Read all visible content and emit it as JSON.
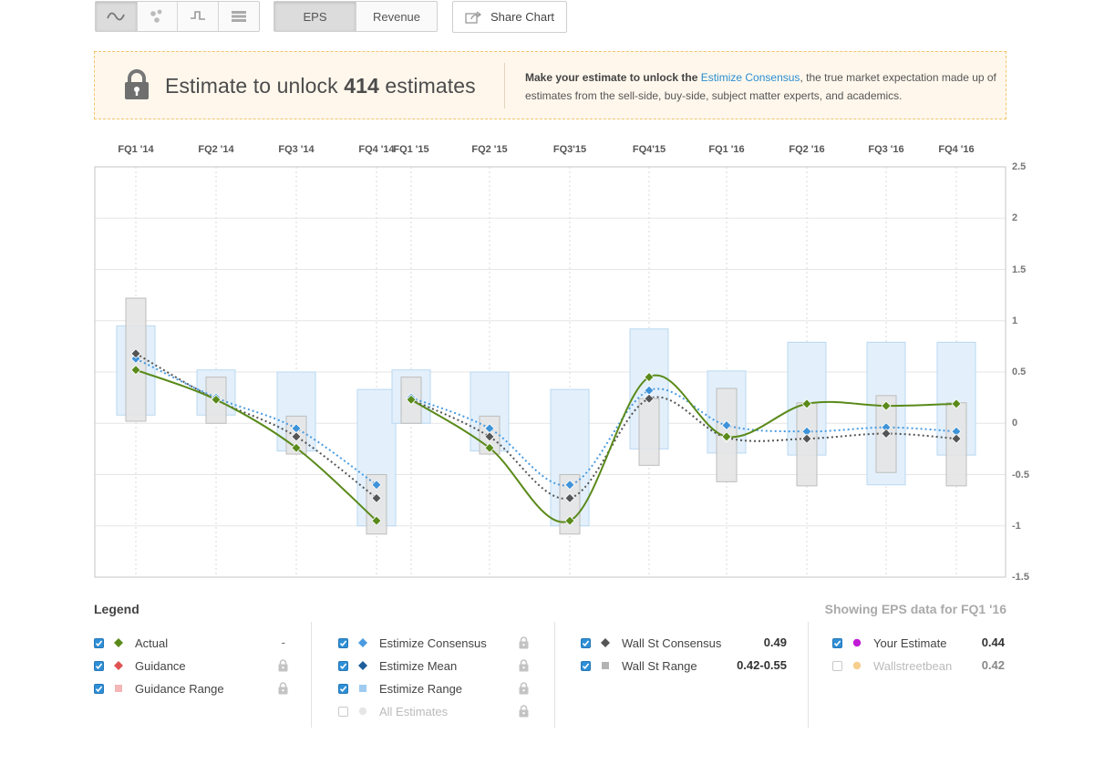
{
  "toolbar": {
    "view_icons": [
      "line-chart-icon",
      "scatter-icon",
      "step-chart-icon",
      "table-icon"
    ],
    "metric_tabs": [
      "EPS",
      "Revenue"
    ],
    "share_label": "Share Chart"
  },
  "banner": {
    "headline_prefix": "Estimate to unlock ",
    "headline_count": "414",
    "headline_suffix": " estimates",
    "text_lead": "Make your estimate to unlock the ",
    "text_link": "Estimize Consensus",
    "text_rest": ", the true market expectation made up of estimates from the sell-side, buy-side, subject matter experts, and academics."
  },
  "chart_data": {
    "type": "line",
    "categories": [
      "FQ1 '14",
      "FQ2 '14",
      "FQ3 '14",
      "FQ4 '14",
      "FQ1 '15",
      "FQ2 '15",
      "FQ3'15",
      "FQ4'15",
      "FQ1 '16",
      "FQ2 '16",
      "FQ3 '16",
      "FQ4 '16"
    ],
    "y_ticks": [
      "2.5",
      "2",
      "1.5",
      "1",
      "0.5",
      "0",
      "-0.5",
      "-1",
      "-1.5"
    ],
    "ylim": [
      -1.5,
      2.5
    ],
    "grid": true,
    "series": [
      {
        "name": "Actual",
        "color": "#5a8a1a",
        "values": [
          0.52,
          0.23,
          -0.24,
          -0.95,
          0.23,
          -0.24,
          -0.95,
          0.45,
          -0.13,
          0.19,
          0.17,
          0.19
        ]
      },
      {
        "name": "Estimize Consensus",
        "color": "#3f93d8",
        "values": [
          0.63,
          0.25,
          -0.05,
          -0.6,
          0.25,
          -0.05,
          -0.6,
          0.32,
          -0.02,
          -0.08,
          -0.04,
          -0.08
        ]
      },
      {
        "name": "Wall St Consensus",
        "color": "#555555",
        "values": [
          0.68,
          0.23,
          -0.13,
          -0.73,
          0.23,
          -0.13,
          -0.73,
          0.24,
          -0.14,
          -0.15,
          -0.1,
          -0.15
        ]
      }
    ],
    "estimize_range": [
      [
        0.08,
        0.95
      ],
      [
        0.08,
        0.52
      ],
      [
        -0.27,
        0.5
      ],
      [
        -1.0,
        0.33
      ],
      [
        0.0,
        0.52
      ],
      [
        -0.27,
        0.5
      ],
      [
        -1.0,
        0.33
      ],
      [
        -0.25,
        0.92
      ],
      [
        -0.29,
        0.51
      ],
      [
        -0.31,
        0.79
      ],
      [
        -0.6,
        0.79
      ],
      [
        -0.31,
        0.79
      ]
    ],
    "wallst_range": [
      [
        0.02,
        1.22
      ],
      [
        0.0,
        0.45
      ],
      [
        -0.3,
        0.07
      ],
      [
        -1.08,
        -0.5
      ],
      [
        0.0,
        0.45
      ],
      [
        -0.3,
        0.07
      ],
      [
        -1.08,
        -0.5
      ],
      [
        -0.41,
        0.24
      ],
      [
        -0.57,
        0.34
      ],
      [
        -0.61,
        0.2
      ],
      [
        -0.48,
        0.27
      ],
      [
        -0.61,
        0.2
      ]
    ]
  },
  "legend": {
    "title": "Legend",
    "showing": "Showing EPS data for FQ1 '16",
    "col1": [
      {
        "label": "Actual",
        "value": "-",
        "marker": "diamond",
        "color": "#5a8a1a",
        "checked": true
      },
      {
        "label": "Guidance",
        "marker": "diamond",
        "color": "#e05252",
        "checked": true,
        "locked": true
      },
      {
        "label": "Guidance Range",
        "marker": "square",
        "color": "#f4b6b6",
        "checked": true,
        "locked": true
      }
    ],
    "col2": [
      {
        "label": "Estimize Consensus",
        "marker": "diamond",
        "color": "#4a9be0",
        "checked": true,
        "locked": true
      },
      {
        "label": "Estimize Mean",
        "marker": "diamond",
        "color": "#1d5e9c",
        "checked": true,
        "locked": true
      },
      {
        "label": "Estimize Range",
        "marker": "square",
        "color": "#9fcbf0",
        "checked": true,
        "locked": true
      },
      {
        "label": "All Estimates",
        "marker": "circle",
        "color": "#e6e6e6",
        "checked": false,
        "locked": true
      }
    ],
    "col3": [
      {
        "label": "Wall St Consensus",
        "value": "0.49",
        "marker": "diamond",
        "color": "#555555",
        "checked": true
      },
      {
        "label": "Wall St Range",
        "value": "0.42-0.55",
        "marker": "square",
        "color": "#b3b3b3",
        "checked": true
      }
    ],
    "col4": [
      {
        "label": "Your Estimate",
        "value": "0.44",
        "marker": "circle",
        "color": "#c21bd6",
        "checked": true
      },
      {
        "label": "Wallstreetbean",
        "value": "0.42",
        "marker": "circle",
        "color": "#f6cf8f",
        "checked": false
      }
    ]
  }
}
